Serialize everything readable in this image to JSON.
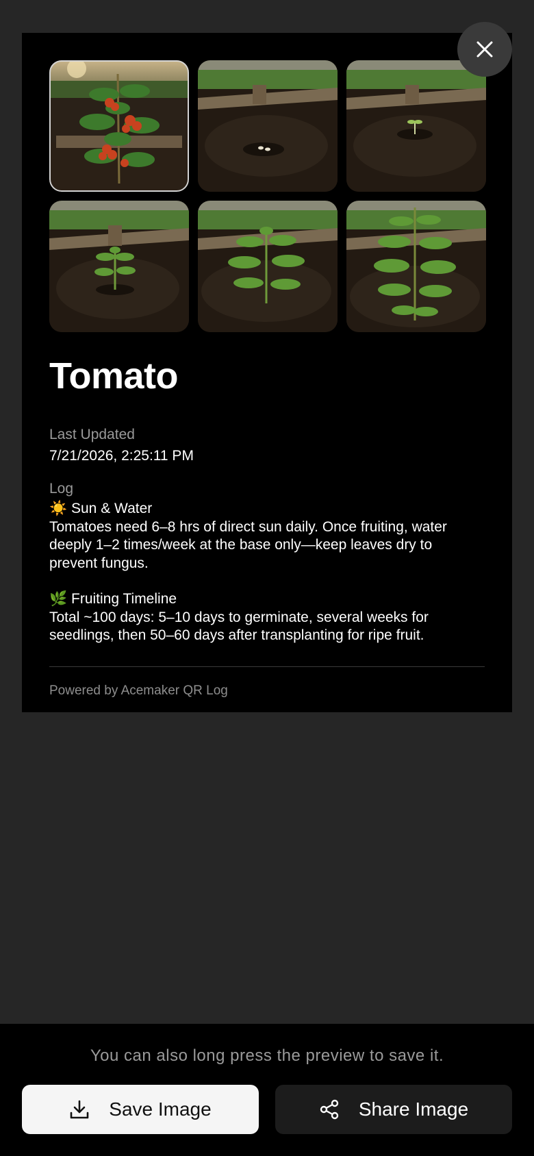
{
  "plant": {
    "name": "Tomato",
    "last_updated_label": "Last Updated",
    "last_updated_value": "7/21/2026, 2:25:11 PM",
    "log_label": "Log",
    "log_sections": [
      {
        "emoji": "☀️",
        "heading": "Sun & Water",
        "body": "Tomatoes need 6–8 hrs of direct sun daily. Once fruiting, water deeply 1–2 times/week at the base only—keep leaves dry to prevent fungus."
      },
      {
        "emoji": "🌿",
        "heading": "Fruiting Timeline",
        "body": "Total ~100 days: 5–10 days to germinate, several weeks for seedlings, then 50–60 days after transplanting for ripe fruit."
      }
    ],
    "powered_by": "Powered by Acemaker QR Log"
  },
  "gallery": {
    "selected_index": 0,
    "stages": [
      "fruiting-tomato-plant",
      "seeds-in-soil",
      "sprout",
      "seedling",
      "young-plant",
      "mature-plant"
    ]
  },
  "footer": {
    "hint": "You can also long press the preview to save it.",
    "save_label": "Save Image",
    "share_label": "Share Image"
  },
  "icons": {
    "close": "close-icon",
    "save": "download-icon",
    "share": "share-icon"
  },
  "colors": {
    "background": "#262626",
    "card": "#000000",
    "save_button": "#f5f5f5",
    "share_button": "#1c1c1c"
  }
}
